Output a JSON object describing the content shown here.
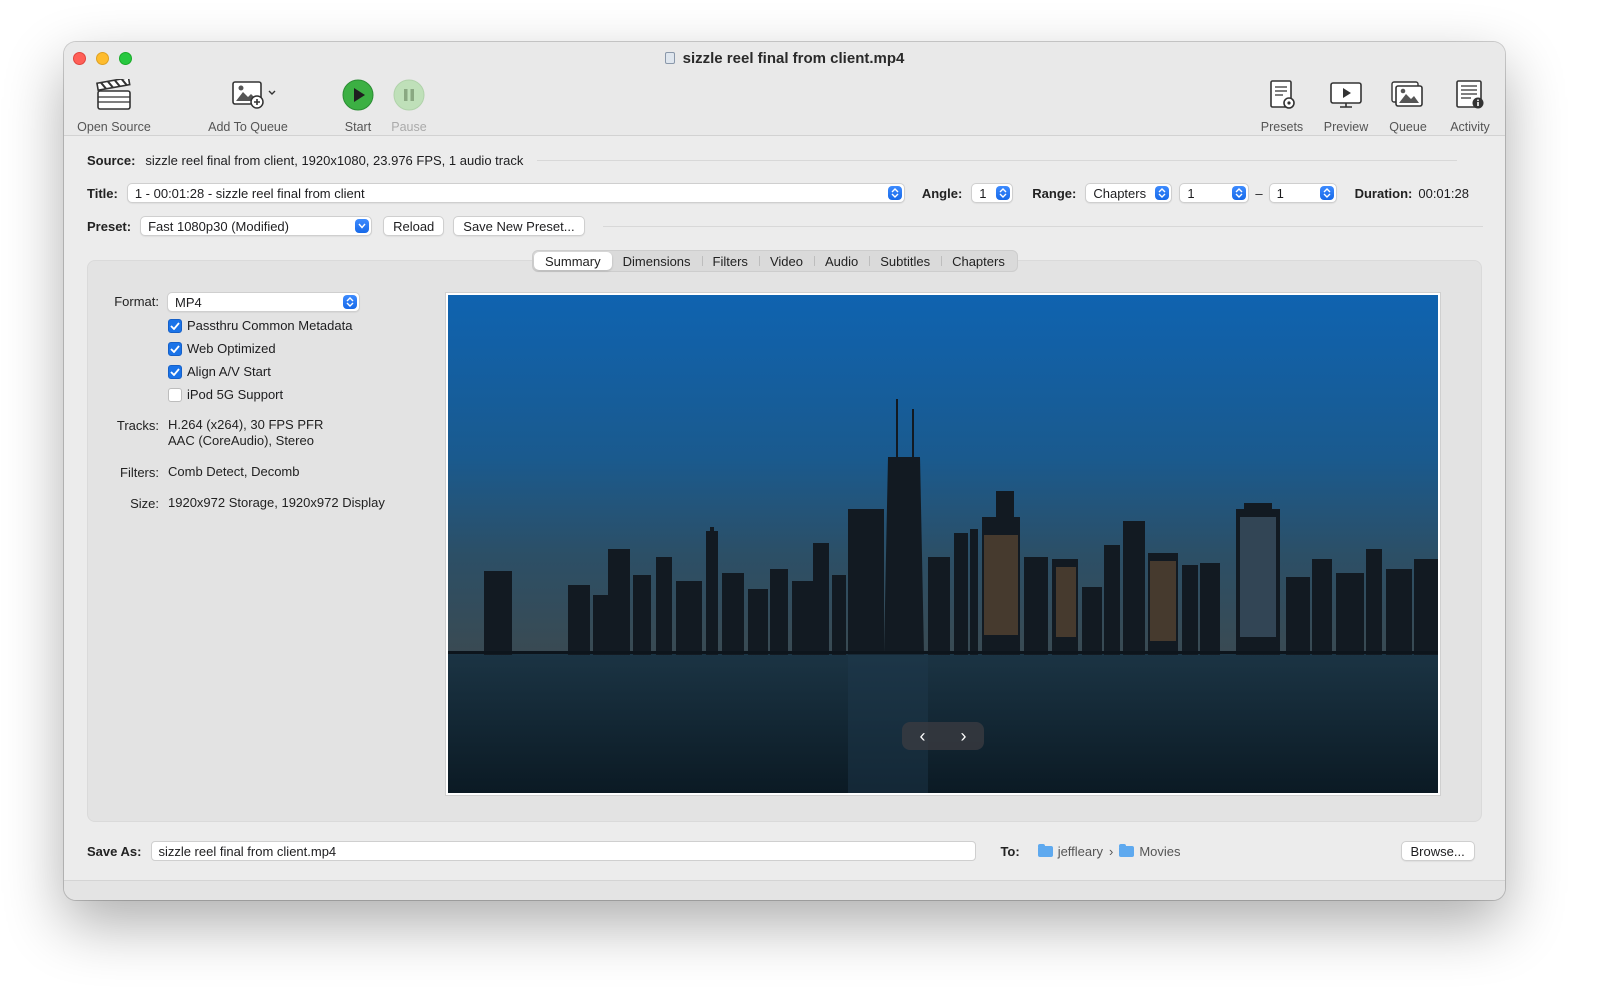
{
  "window": {
    "title": "sizzle reel final from client.mp4"
  },
  "toolbar": {
    "left": [
      {
        "label": "Open Source",
        "icon": "clapperboard-icon"
      },
      {
        "label": "Add To Queue",
        "icon": "add-to-queue-icon"
      },
      {
        "label": "Start",
        "icon": "play-icon"
      },
      {
        "label": "Pause",
        "icon": "pause-icon"
      }
    ],
    "right": [
      {
        "label": "Presets",
        "icon": "presets-icon"
      },
      {
        "label": "Preview",
        "icon": "preview-icon"
      },
      {
        "label": "Queue",
        "icon": "queue-icon"
      },
      {
        "label": "Activity",
        "icon": "activity-icon"
      }
    ]
  },
  "source": {
    "label": "Source:",
    "value": "sizzle reel final from client, 1920x1080, 23.976 FPS, 1 audio track"
  },
  "title_row": {
    "label": "Title:",
    "value": "1 - 00:01:28 - sizzle reel final from client",
    "angle_label": "Angle:",
    "angle_value": "1",
    "range_label": "Range:",
    "range_type": "Chapters",
    "range_start": "1",
    "range_dash": "–",
    "range_end": "1",
    "duration_label": "Duration:",
    "duration_value": "00:01:28"
  },
  "preset_row": {
    "label": "Preset:",
    "value": "Fast 1080p30 (Modified)",
    "reload": "Reload",
    "save_new": "Save New Preset..."
  },
  "tabs": [
    "Summary",
    "Dimensions",
    "Filters",
    "Video",
    "Audio",
    "Subtitles",
    "Chapters"
  ],
  "summary": {
    "format_label": "Format:",
    "format_value": "MP4",
    "checkboxes": [
      {
        "label": "Passthru Common Metadata",
        "checked": true
      },
      {
        "label": "Web Optimized",
        "checked": true
      },
      {
        "label": "Align A/V Start",
        "checked": true
      },
      {
        "label": "iPod 5G Support",
        "checked": false
      }
    ],
    "tracks_label": "Tracks:",
    "tracks_line1": "H.264 (x264), 30 FPS PFR",
    "tracks_line2": "AAC (CoreAudio), Stereo",
    "filters_label": "Filters:",
    "filters_value": "Comb Detect, Decomb",
    "size_label": "Size:",
    "size_value": "1920x972 Storage, 1920x972 Display"
  },
  "preview_nav": {
    "prev": "‹",
    "next": "›"
  },
  "save": {
    "label": "Save As:",
    "value": "sizzle reel final from client.mp4",
    "to_label": "To:",
    "path_user": "jeffleary",
    "path_sep": "›",
    "path_folder": "Movies",
    "browse": "Browse..."
  },
  "colors": {
    "accent": "#1a73e8",
    "start_green": "#3cb043",
    "sky_top": "#0f5fa8",
    "water": "#0f2230"
  }
}
